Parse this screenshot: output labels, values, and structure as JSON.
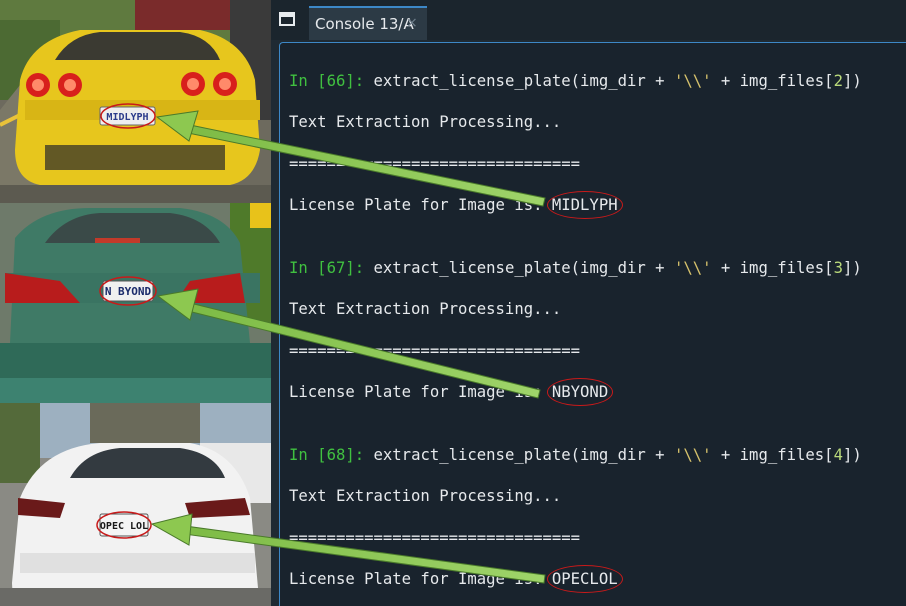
{
  "console": {
    "tab_label": "Console 13/A",
    "tab_close": "×",
    "entries": [
      {
        "prompt": "In [",
        "number": "66",
        "prompt_end": "]:",
        "code_prefix": " extract_license_plate(img_dir + ",
        "code_string": "'\\\\'",
        "code_mid": " + img_files[",
        "code_index": "2",
        "code_end": "])",
        "processing": "Text Extraction Processing...",
        "separator": "===============================",
        "result_label": "License Plate for Image is: ",
        "result_value": "MIDLYPH"
      },
      {
        "prompt": "In [",
        "number": "67",
        "prompt_end": "]:",
        "code_prefix": " extract_license_plate(img_dir + ",
        "code_string": "'\\\\'",
        "code_mid": " + img_files[",
        "code_index": "3",
        "code_end": "])",
        "processing": "Text Extraction Processing...",
        "separator": "===============================",
        "result_label": "License Plate for Image is: ",
        "result_value": "NBYOND"
      },
      {
        "prompt": "In [",
        "number": "68",
        "prompt_end": "]:",
        "code_prefix": " extract_license_plate(img_dir + ",
        "code_string": "'\\\\'",
        "code_mid": " + img_files[",
        "code_index": "4",
        "code_end": "])",
        "processing": "Text Extraction Processing...",
        "separator": "===============================",
        "result_label": "License Plate for Image is: ",
        "result_value": "OPECLOL"
      }
    ]
  },
  "photos": [
    {
      "plate_text": "MIDLYPH",
      "car": "yellow sports car, rear view"
    },
    {
      "plate_text": "N BYOND",
      "car": "green sedan, rear view"
    },
    {
      "plate_text": "OPEC LOL",
      "car": "white sedan, rear view"
    }
  ],
  "colors": {
    "console_bg": "#19232d",
    "prompt": "#40c040",
    "string": "#d6c26c",
    "highlight_ring": "#c81a1a",
    "arrow": "#8dc850"
  }
}
